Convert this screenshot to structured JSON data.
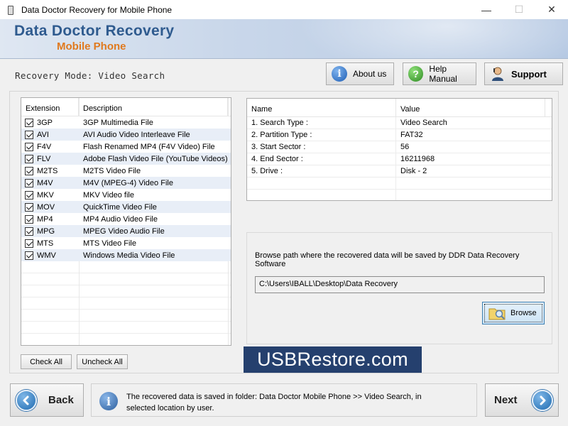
{
  "window": {
    "title": "Data Doctor Recovery for Mobile Phone",
    "minimize_icon": "minimize-icon",
    "maximize_icon": "maximize-icon",
    "close_icon": "close-icon",
    "minimize_glyph": "—",
    "maximize_glyph": "☐",
    "close_glyph": "✕"
  },
  "banner": {
    "brand_main": "Data Doctor Recovery",
    "brand_sub": "Mobile Phone"
  },
  "mode": {
    "label": "Recovery Mode: Video Search"
  },
  "header_buttons": {
    "about": "About us",
    "help": "Help Manual",
    "support": "Support"
  },
  "extensions": {
    "headers": [
      "Extension",
      "Description"
    ],
    "rows": [
      {
        "ext": "3GP",
        "desc": "3GP Multimedia File",
        "checked": true
      },
      {
        "ext": "AVI",
        "desc": "AVI Audio Video Interleave File",
        "checked": true
      },
      {
        "ext": "F4V",
        "desc": "Flash Renamed MP4 (F4V Video) File",
        "checked": true
      },
      {
        "ext": "FLV",
        "desc": "Adobe Flash Video File (YouTube Videos)",
        "checked": true
      },
      {
        "ext": "M2TS",
        "desc": "M2TS Video File",
        "checked": true
      },
      {
        "ext": "M4V",
        "desc": "M4V (MPEG-4) Video File",
        "checked": true
      },
      {
        "ext": "MKV",
        "desc": "MKV Video file",
        "checked": true
      },
      {
        "ext": "MOV",
        "desc": "QuickTime Video File",
        "checked": true
      },
      {
        "ext": "MP4",
        "desc": "MP4 Audio Video File",
        "checked": true
      },
      {
        "ext": "MPG",
        "desc": "MPEG Video Audio File",
        "checked": true
      },
      {
        "ext": "MTS",
        "desc": "MTS Video File",
        "checked": true
      },
      {
        "ext": "WMV",
        "desc": "Windows Media Video File",
        "checked": true
      }
    ],
    "check_all": "Check All",
    "uncheck_all": "Uncheck All"
  },
  "properties": {
    "headers": [
      "Name",
      "Value"
    ],
    "rows": [
      {
        "name": "1. Search Type :",
        "value": "Video Search"
      },
      {
        "name": "2. Partition Type :",
        "value": "FAT32"
      },
      {
        "name": "3. Start Sector :",
        "value": "56"
      },
      {
        "name": "4. End Sector :",
        "value": "16211968"
      },
      {
        "name": "5. Drive :",
        "value": "Disk - 2"
      }
    ]
  },
  "browse": {
    "label": "Browse path where the recovered data will be saved by DDR Data Recovery Software",
    "path": "C:\\Users\\IBALL\\Desktop\\Data Recovery",
    "button": "Browse"
  },
  "watermark": "USBRestore.com",
  "footer": {
    "back": "Back",
    "next": "Next",
    "info_line1": "The recovered data is saved in folder: Data Doctor Mobile Phone  >> Video Search, in",
    "info_line2": "selected location by user."
  }
}
